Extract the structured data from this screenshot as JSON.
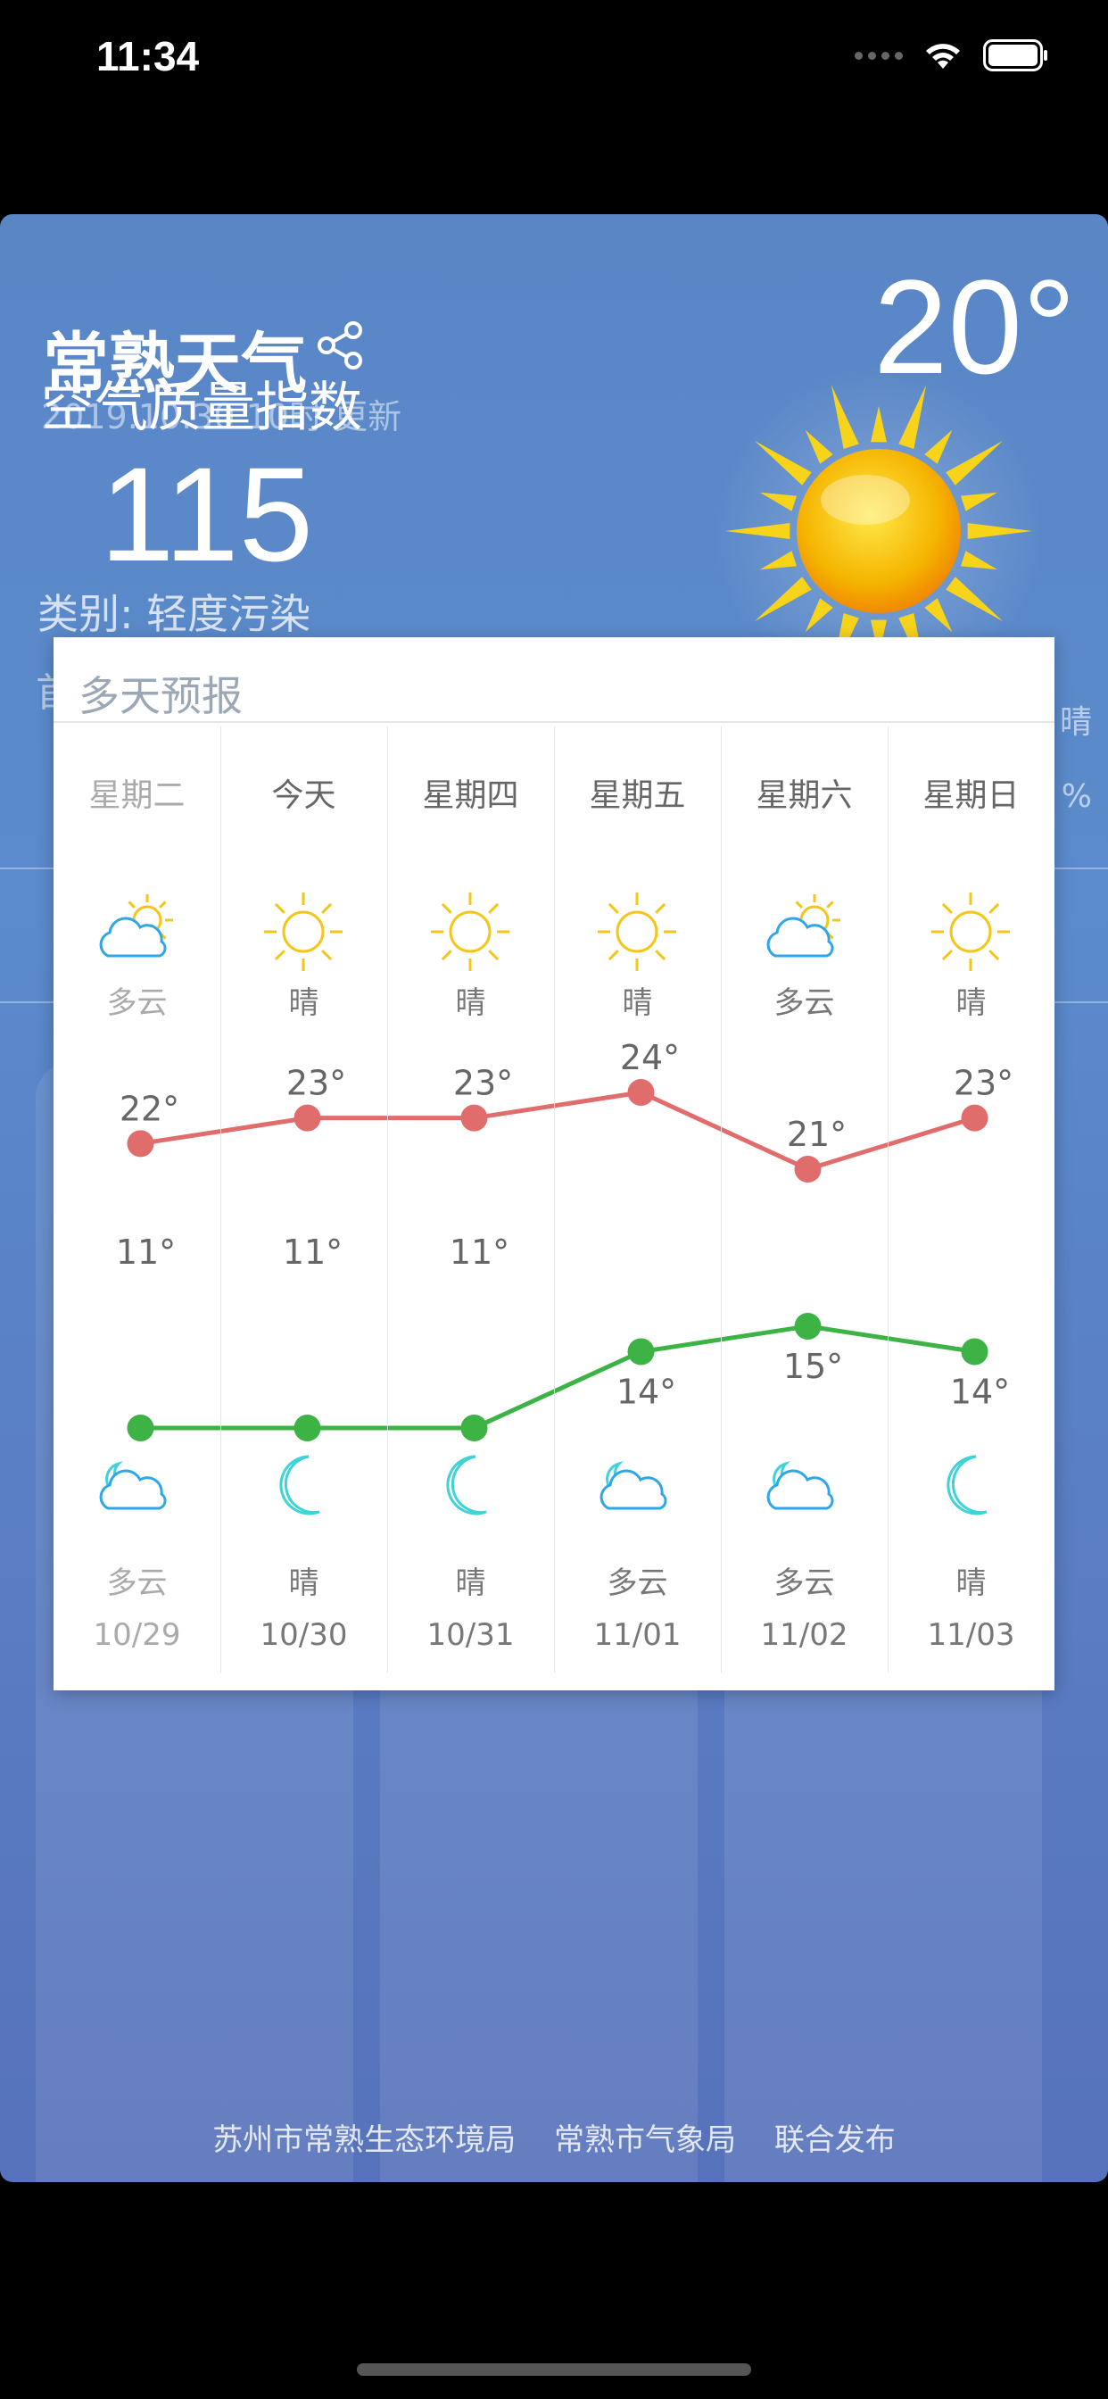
{
  "status_bar": {
    "time": "11:34"
  },
  "header": {
    "city_title": "常熟天气",
    "update_time": "2019.10.30 10时 更新",
    "current_temp": "20°"
  },
  "aqi": {
    "title": "空气质量指数",
    "value": "115",
    "category": "类别: 轻度污染",
    "primary_fragment": "首"
  },
  "right_fragments": {
    "percent": "%",
    "char": "晴"
  },
  "forecast": {
    "title": "多天预报",
    "days": [
      {
        "weekday": "星期二",
        "day_cond": "多云",
        "day_icon": "partly-cloudy-day-icon",
        "high": "22°",
        "low": "11°",
        "night_icon": "partly-cloudy-night-icon",
        "night_cond": "多云",
        "date": "10/29",
        "past": true
      },
      {
        "weekday": "今天",
        "day_cond": "晴",
        "day_icon": "sun-icon",
        "high": "23°",
        "low": "11°",
        "night_icon": "moon-icon",
        "night_cond": "晴",
        "date": "10/30",
        "past": false
      },
      {
        "weekday": "星期四",
        "day_cond": "晴",
        "day_icon": "sun-icon",
        "high": "23°",
        "low": "11°",
        "night_icon": "moon-icon",
        "night_cond": "晴",
        "date": "10/31",
        "past": false
      },
      {
        "weekday": "星期五",
        "day_cond": "晴",
        "day_icon": "sun-icon",
        "high": "24°",
        "low": "14°",
        "night_icon": "partly-cloudy-night-icon",
        "night_cond": "多云",
        "date": "11/01",
        "past": false
      },
      {
        "weekday": "星期六",
        "day_cond": "多云",
        "day_icon": "partly-cloudy-day-icon",
        "high": "21°",
        "low": "15°",
        "night_icon": "partly-cloudy-night-icon",
        "night_cond": "多云",
        "date": "11/02",
        "past": false
      },
      {
        "weekday": "星期日",
        "day_cond": "晴",
        "day_icon": "sun-icon",
        "high": "23°",
        "low": "14°",
        "night_icon": "moon-icon",
        "night_cond": "晴",
        "date": "11/03",
        "past": false
      }
    ]
  },
  "chart_data": {
    "type": "line",
    "categories": [
      "10/29",
      "10/30",
      "10/31",
      "11/01",
      "11/02",
      "11/03"
    ],
    "series": [
      {
        "values": [
          22,
          23,
          23,
          24,
          21,
          23
        ],
        "color": "#e06c6c"
      },
      {
        "values": [
          11,
          11,
          11,
          14,
          15,
          14
        ],
        "color": "#3db346"
      }
    ]
  },
  "footer": {
    "org1": "苏州市常熟生态环境局",
    "org2": "常熟市气象局",
    "org3": "联合发布"
  },
  "colors": {
    "high_line": "#e06c6c",
    "low_line": "#3db346",
    "sun": "#f5c518",
    "moon": "#3dd3d9",
    "cloud": "#2fa6e8"
  }
}
